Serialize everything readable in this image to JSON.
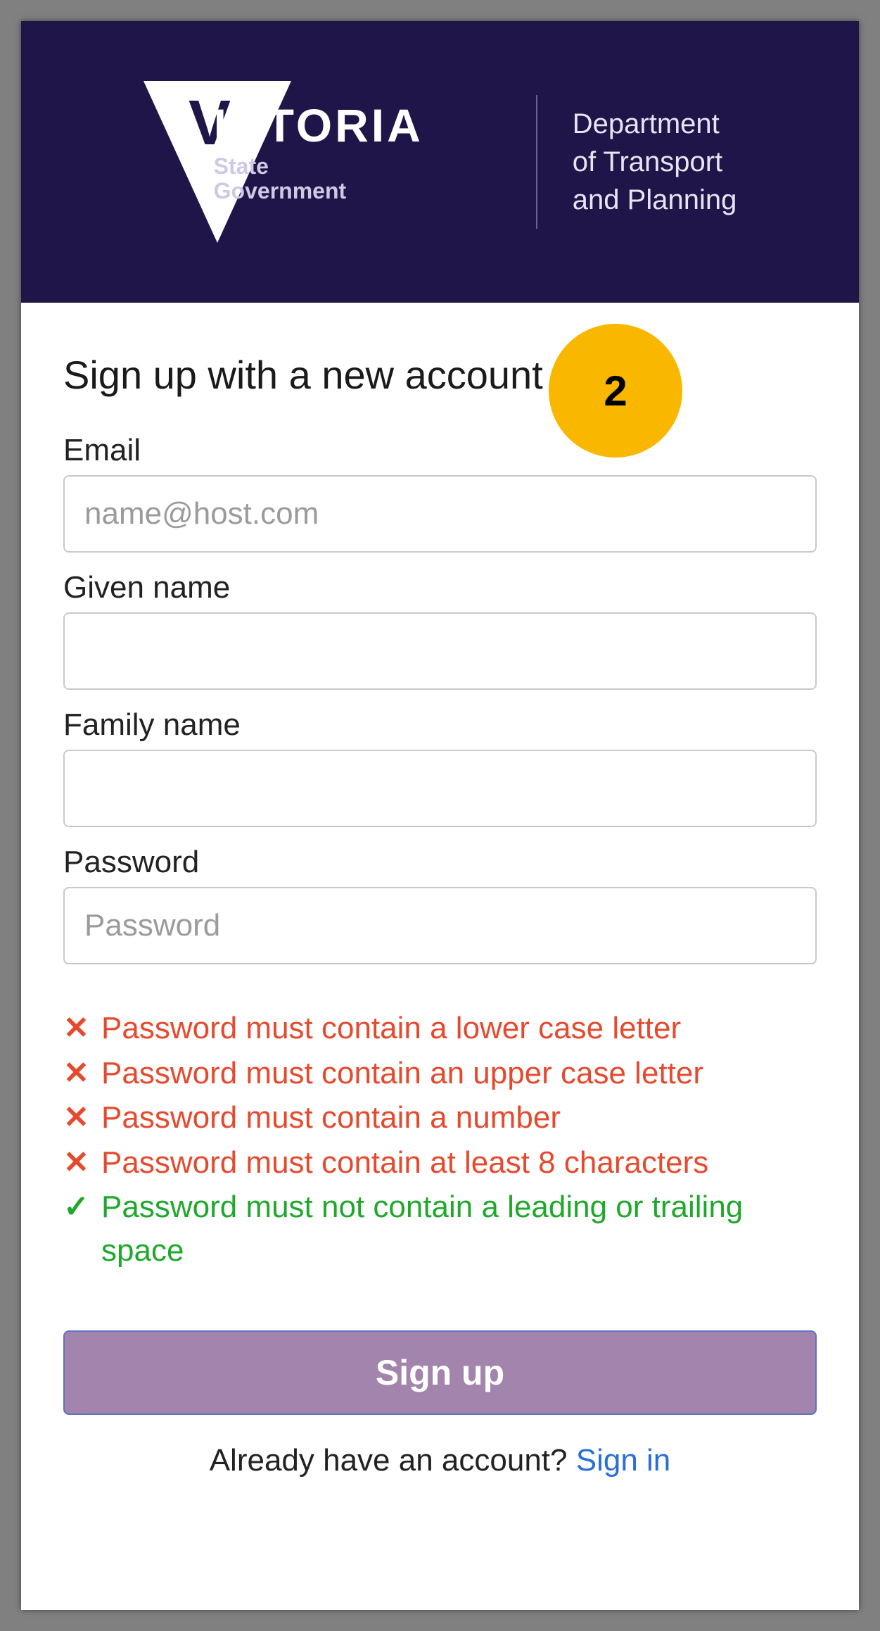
{
  "header": {
    "logo_main": "ICTORIA",
    "logo_sub1": "State",
    "logo_sub2": "Government",
    "dept_line1": "Department",
    "dept_line2": "of Transport",
    "dept_line3": "and Planning"
  },
  "callout": {
    "number": "2"
  },
  "form": {
    "title": "Sign up with a new account",
    "email_label": "Email",
    "email_placeholder": "name@host.com",
    "given_label": "Given name",
    "family_label": "Family name",
    "password_label": "Password",
    "password_placeholder": "Password",
    "rules": [
      {
        "status": "fail",
        "text": "Password must contain a lower case letter"
      },
      {
        "status": "fail",
        "text": "Password must contain an upper case letter"
      },
      {
        "status": "fail",
        "text": "Password must contain a number"
      },
      {
        "status": "fail",
        "text": "Password must contain at least 8 characters"
      },
      {
        "status": "pass",
        "text": "Password must not contain a leading or trailing space"
      }
    ],
    "submit": "Sign up",
    "footer_prompt": "Already have an account? ",
    "footer_link": "Sign in"
  },
  "glyphs": {
    "fail": "✕",
    "pass": "✓"
  }
}
